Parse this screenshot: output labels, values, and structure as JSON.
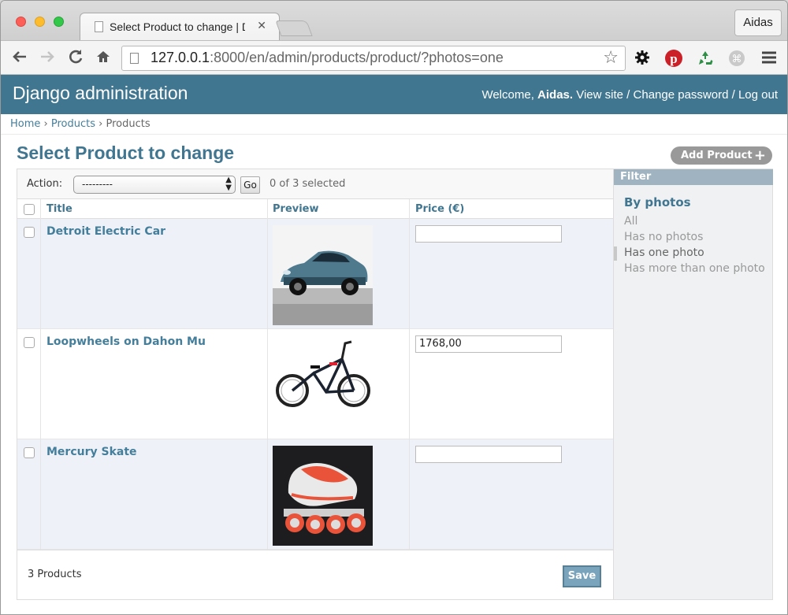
{
  "browser": {
    "tab_title": "Select Product to change | Dj",
    "tab_close": "✕",
    "profile_name": "Aidas",
    "url_host": "127.0.0.1",
    "url_rest": ":8000/en/admin/products/product/?photos=one"
  },
  "header": {
    "branding": "Django administration",
    "welcome": "Welcome,",
    "username": "Aidas.",
    "view_site": "View site",
    "change_password": "Change password",
    "log_out": "Log out",
    "separator": "/"
  },
  "breadcrumbs": {
    "home": "Home",
    "app": "Products",
    "model": "Products",
    "separator": "›"
  },
  "page": {
    "title": "Select Product to change",
    "add_button": "Add Product"
  },
  "actions": {
    "label": "Action:",
    "selected_value": "---------",
    "go_label": "Go",
    "selected_count": "0 of 3 selected"
  },
  "table": {
    "columns": [
      "Title",
      "Preview",
      "Price (€)"
    ],
    "rows": [
      {
        "title": "Detroit Electric Car",
        "preview": "car",
        "price": ""
      },
      {
        "title": "Loopwheels on Dahon Mu",
        "preview": "bicycle",
        "price": "1768,00"
      },
      {
        "title": "Mercury Skate",
        "preview": "skate",
        "price": ""
      }
    ]
  },
  "footer": {
    "count": "3 Products",
    "save_label": "Save"
  },
  "filter": {
    "title": "Filter",
    "heading": "By photos",
    "items": [
      "All",
      "Has no photos",
      "Has one photo",
      "Has more than one photo"
    ],
    "selected_index": 2
  },
  "colors": {
    "header_bg": "#417690",
    "link": "#447e9b",
    "filter_title_bg": "#9fb3c1"
  }
}
